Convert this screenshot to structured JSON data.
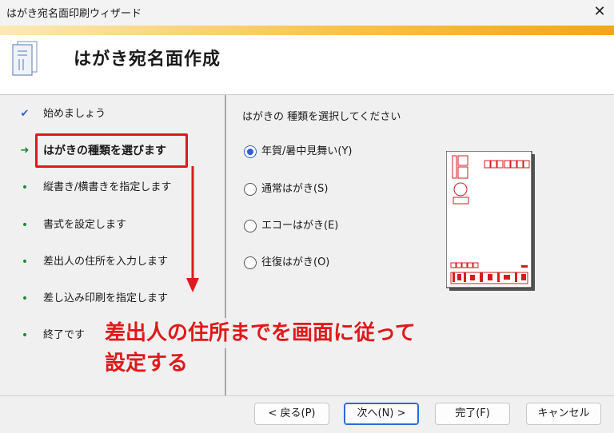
{
  "window": {
    "title": "はがき宛名面印刷ウィザード",
    "close_glyph": "✕"
  },
  "header": {
    "title": "はがき宛名面作成",
    "icon": "wizard-card-icon"
  },
  "steps": [
    {
      "marker": "✔",
      "label": "始めましょう",
      "state": "done"
    },
    {
      "marker": "➜",
      "label": "はがきの種類を選びます",
      "state": "current"
    },
    {
      "marker": "•",
      "label": "縦書き/横書きを指定します",
      "state": "pending"
    },
    {
      "marker": "•",
      "label": "書式を設定します",
      "state": "pending"
    },
    {
      "marker": "•",
      "label": "差出人の住所を入力します",
      "state": "pending"
    },
    {
      "marker": "•",
      "label": "差し込み印刷を指定します",
      "state": "pending"
    },
    {
      "marker": "•",
      "label": "終了です",
      "state": "pending"
    }
  ],
  "content": {
    "prompt": "はがきの 種類を選択してください",
    "options": [
      {
        "label": "年賀/暑中見舞い(Y)",
        "selected": true
      },
      {
        "label": "通常はがき(S)",
        "selected": false
      },
      {
        "label": "エコーはがき(E)",
        "selected": false
      },
      {
        "label": "往復はがき(O)",
        "selected": false
      }
    ]
  },
  "buttons": {
    "back": "< 戻る(P)",
    "next": "次へ(N) >",
    "finish": "完了(F)",
    "cancel": "キャンセル"
  },
  "annotation": {
    "line1": "差出人の住所までを画面に従って",
    "line2": "設定する"
  },
  "colors": {
    "accent": "#f2a716",
    "annotation": "#e0191b",
    "radio": "#2d5fd2",
    "step_current": "#1f8a2e"
  }
}
